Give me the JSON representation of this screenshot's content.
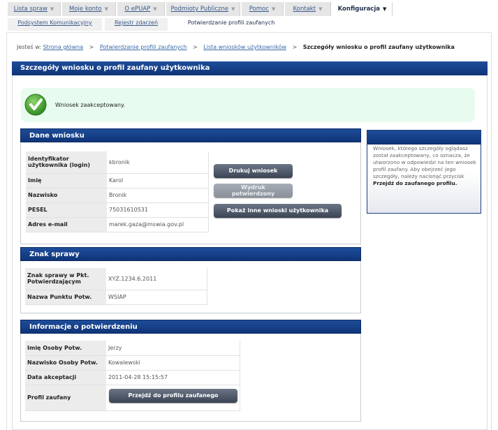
{
  "topnav": {
    "tabs": [
      {
        "label": "Lista spraw"
      },
      {
        "label": "Moje konto"
      },
      {
        "label": "O ePUAP"
      },
      {
        "label": "Podmioty Publiczne"
      },
      {
        "label": "Pomoc"
      },
      {
        "label": "Kontakt"
      },
      {
        "label": "Konfiguracja"
      }
    ],
    "caret": "▼"
  },
  "subnav": {
    "tabs": [
      {
        "label": "Podsystem Komunikacyjny"
      },
      {
        "label": "Rejestr zdarzeń"
      },
      {
        "label": "Potwierdzanie profili zaufanych"
      }
    ]
  },
  "breadcrumb": {
    "prefix": "Jesteś w:",
    "items": [
      "Strona główna",
      "Potwierdzanie profili zaufanych",
      "Lista wniosków użytkowników"
    ],
    "current": "Szczegóły wniosku o profil zaufany użytkownika",
    "separator": ">"
  },
  "page_title": "Szczegóły wniosku o profil zaufany użytkownika",
  "success_message": "Wniosek zaakceptowany.",
  "dane_wniosku": {
    "title": "Dane wniosku",
    "rows": [
      {
        "label": "Identyfikator użytkownika (login)",
        "value": "kbronik"
      },
      {
        "label": "Imię",
        "value": "Karol"
      },
      {
        "label": "Nazwisko",
        "value": "Bronik"
      },
      {
        "label": "PESEL",
        "value": "75031610531"
      },
      {
        "label": "Adres e-mail",
        "value": "marek.gaza@mswia.gov.pl"
      }
    ],
    "buttons": {
      "print": "Drukuj wniosek",
      "printout_line1": "Wydruk",
      "printout_line2": "potwierdzony",
      "other": "Pokaż inne wnioski użytkownika"
    }
  },
  "znak_sprawy": {
    "title": "Znak sprawy",
    "rows": [
      {
        "label": "Znak sprawy w Pkt. Potwierdzającym",
        "value": "XYZ.1234.6.2011"
      },
      {
        "label": "Nazwa Punktu Potw.",
        "value": "WSIAP"
      }
    ]
  },
  "informacje": {
    "title": "Informacje o potwierdzeniu",
    "rows": [
      {
        "label": "Imię Osoby Potw.",
        "value": "Jerzy"
      },
      {
        "label": "Nazwisko Osoby Potw.",
        "value": "Kowalewski"
      },
      {
        "label": "Data akceptacji",
        "value": "2011-04-28 15:15:57"
      },
      {
        "label": "Profil zaufany",
        "value": ""
      }
    ],
    "button": "Przejdź do profilu zaufanego"
  },
  "sidebox": {
    "text": "Wniosek, którego szczegóły oglądasz został zaakceptowany, co oznacza, że utworzono w odpowiedzi na ten wniosek profil zaufany. Aby obejrzeć jego szczegóły, należy nacisnąć przycisk",
    "bold": "Przejdź do zaufanego profilu."
  },
  "colors": {
    "header_blue": "#0f3478",
    "success_bg": "#e8fbef",
    "check_green": "#3a9a2a",
    "button_dark": "#3b4454"
  },
  "icons": {
    "check": "check-icon",
    "caret": "caret-down-icon"
  }
}
